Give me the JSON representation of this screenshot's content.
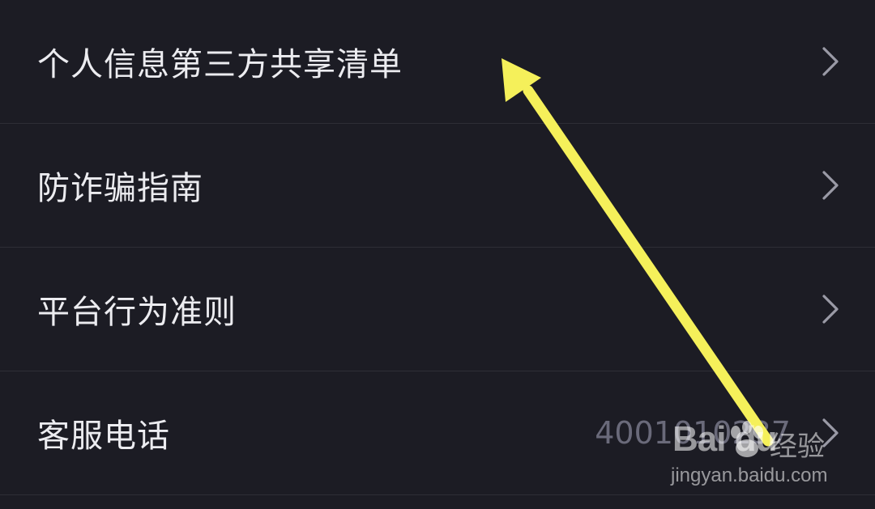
{
  "settings_list": {
    "items": [
      {
        "label": "个人信息第三方共享清单",
        "value": ""
      },
      {
        "label": "防诈骗指南",
        "value": ""
      },
      {
        "label": "平台行为准则",
        "value": ""
      },
      {
        "label": "客服电话",
        "value": "4001010237"
      }
    ]
  },
  "watermark": {
    "brand": "Bai  du",
    "product": "经验",
    "url": "jingyan.baidu.com"
  },
  "colors": {
    "background": "#1c1c24",
    "label_text": "#ececf0",
    "value_text": "#6a6a7a",
    "divider": "#2e2e36",
    "annotation_arrow": "#f5f05a"
  },
  "icons": {
    "row_chevron": "chevron-right-icon",
    "annotation": "arrow-annotation-icon"
  }
}
